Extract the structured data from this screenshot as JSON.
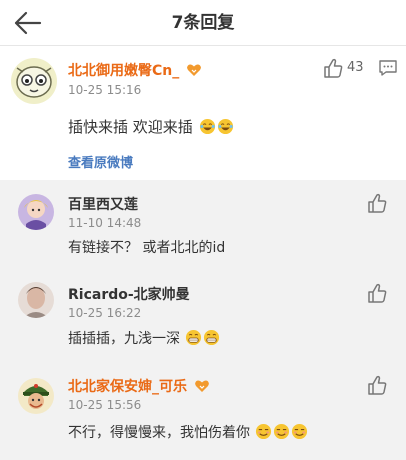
{
  "header": {
    "title": "7条回复"
  },
  "post": {
    "author": "北北御用嫩臀Cn_",
    "time": "10-25 15:16",
    "content": "插快来插 欢迎来插",
    "likes": "43",
    "link": "查看原微博"
  },
  "replies": [
    {
      "author": "百里西又莲",
      "time": "11-10 14:48",
      "content": "有链接不？ 或者北北的id"
    },
    {
      "author": "Ricardo-北家帅曼",
      "time": "10-25 16:22",
      "content": "插插插，九浅一深"
    },
    {
      "author": "北北家保安婶_可乐",
      "time": "10-25 15:56",
      "content": "不行，得慢慢来，我怕伤着你"
    }
  ],
  "colors": {
    "accent_name": "#ea6a16",
    "link": "#4a7bbf",
    "reply_bg": "#f2f2f2"
  }
}
